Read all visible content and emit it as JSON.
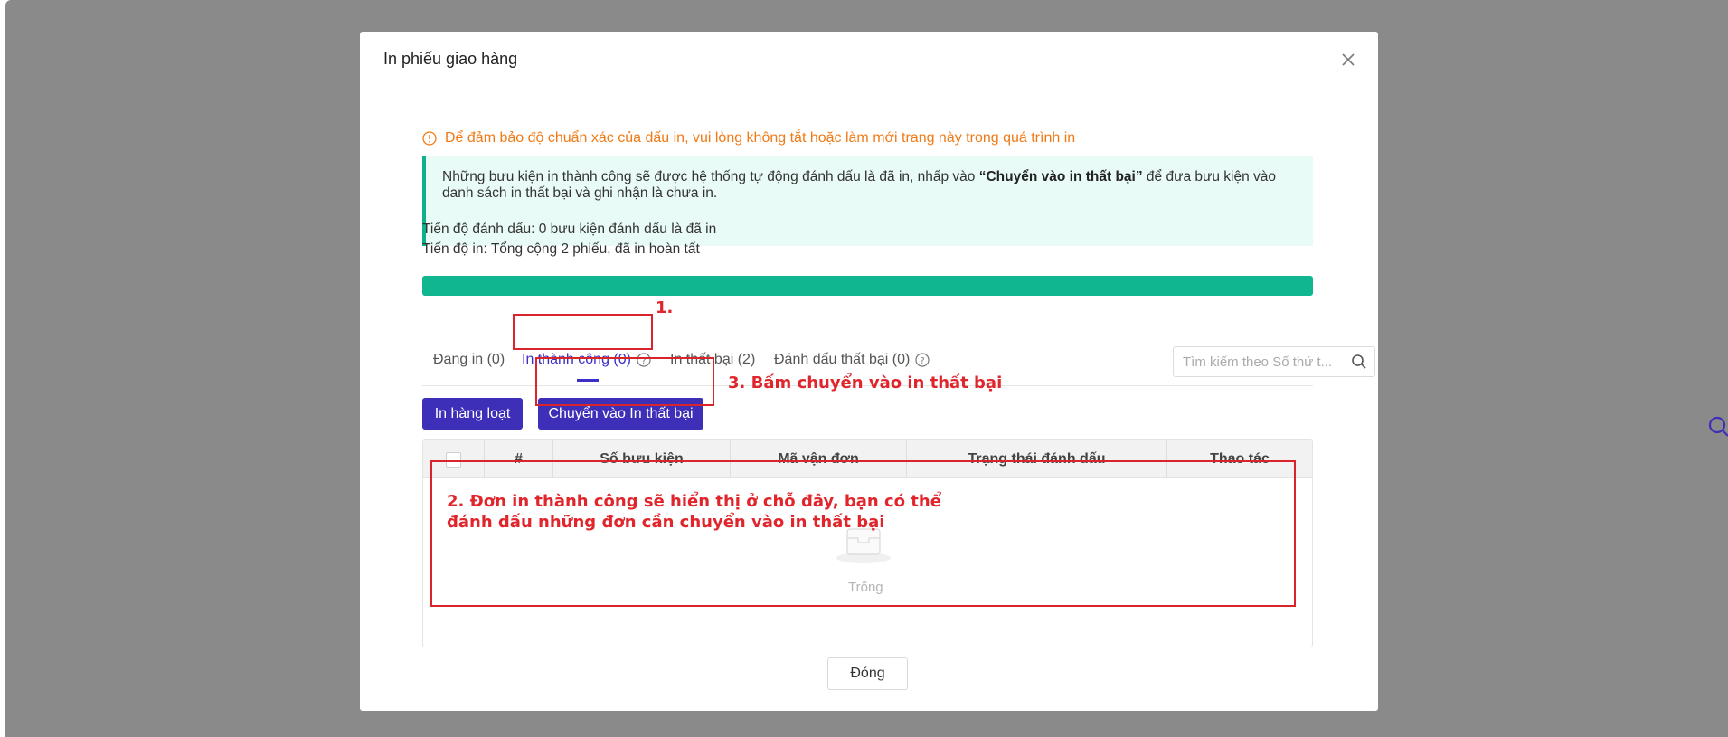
{
  "modal": {
    "title": "In phiếu giao hàng",
    "warning": "Để đảm bảo độ chuẩn xác của dấu in, vui lòng không tắt hoặc làm mới trang này trong quá trình in",
    "info": {
      "part1": "Những bưu kiện in thành công sẽ được hệ thống tự động đánh dấu là đã in, nhấp vào ",
      "bold": "“Chuyển vào in thất bại”",
      "part2": " để đưa bưu kiện vào danh sách in thất bại và ghi nhận là chưa in."
    },
    "mark_progress": "Tiến độ đánh dấu: 0 bưu kiện đánh dấu là đã in",
    "print_progress": "Tiến độ in: Tổng cộng 2 phiếu, đã in hoàn tất",
    "progress_fraction": 1.0,
    "tabs": [
      {
        "label": "Đang in (0)"
      },
      {
        "label": "In thành công (0)"
      },
      {
        "label": "In thất bại (2)"
      },
      {
        "label": "Đánh dấu thất bại (0)"
      }
    ],
    "search_placeholder": "Tìm kiếm theo Số thứ t...",
    "buttons": {
      "bulk_print": "In hàng loạt",
      "move_to_failed": "Chuyển vào In thất bại"
    },
    "table": {
      "columns": [
        "#",
        "Số bưu kiện",
        "Mã vận đơn",
        "Trạng thái đánh dấu",
        "Thao tác"
      ],
      "empty_text": "Trống"
    },
    "close_label": "Đóng"
  },
  "annotations": {
    "step1": "1.",
    "step2_line1": "2. Đơn in thành công sẽ hiển thị ở chỗ đây, bạn có thể",
    "step2_line2": "đánh dấu những đơn cần chuyển vào in thất bại",
    "step3": "3. Bấm chuyển vào in thất bại"
  },
  "colors": {
    "overlay": "#8a8a8a",
    "primary": "#3e2fb8",
    "progress": "#10b68f",
    "warning": "#f07a16",
    "annotation": "#d9242b"
  },
  "icons": {
    "warning": "warning-circle-icon",
    "close": "close-icon",
    "help": "question-circle-icon",
    "search": "search-icon",
    "empty": "empty-box-icon"
  }
}
